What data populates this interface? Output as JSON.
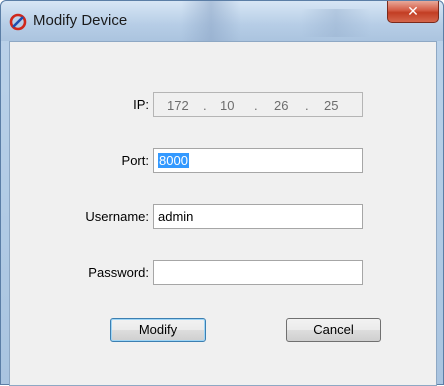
{
  "window": {
    "title": "Modify Device",
    "app_icon": "ban-slash-icon",
    "close_icon": "close-icon",
    "close_glyph": "✕"
  },
  "form": {
    "ip": {
      "label": "IP:",
      "octets": [
        "172",
        "10",
        "26",
        "25"
      ],
      "separator": "."
    },
    "port": {
      "label": "Port:",
      "value": "8000"
    },
    "username": {
      "label": "Username:",
      "value": "admin"
    },
    "password": {
      "label": "Password:",
      "value": ""
    }
  },
  "buttons": {
    "modify": "Modify",
    "cancel": "Cancel"
  },
  "colors": {
    "selection": "#3399ff",
    "close_button": "#c23d23"
  }
}
